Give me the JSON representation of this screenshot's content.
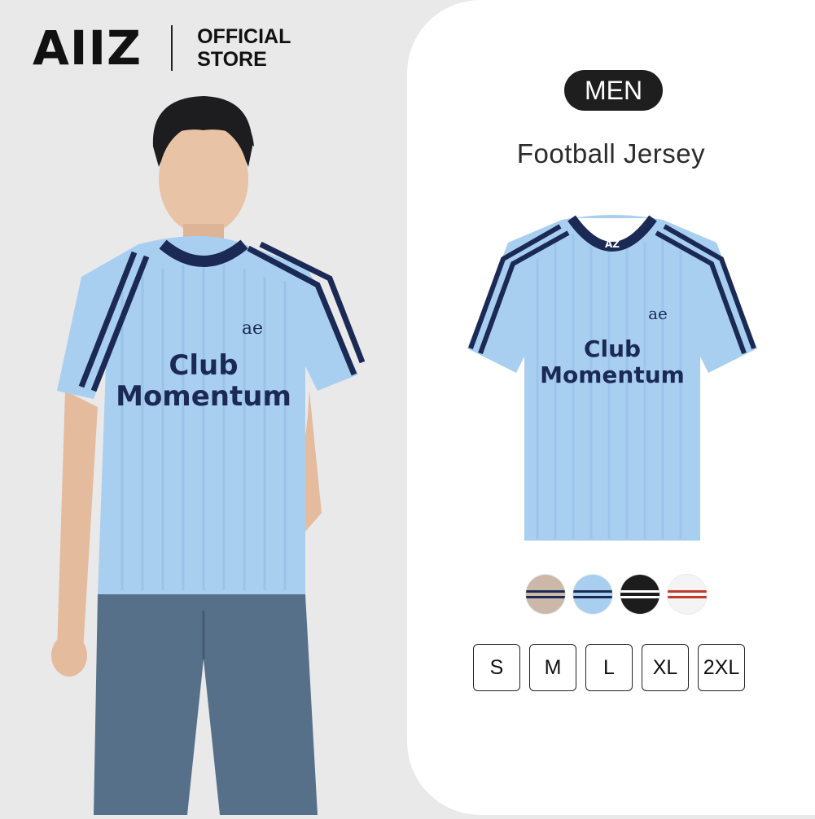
{
  "brand": {
    "logo": "AIIZ",
    "store_line1": "OFFICIAL",
    "store_line2": "STORE"
  },
  "product": {
    "gender": "MEN",
    "name": "Football Jersey",
    "print_line1": "Club",
    "print_line2": "Momentum",
    "chest_logo": "ae",
    "neck_logo": "AZ"
  },
  "colors": {
    "jersey": "#a9cff0",
    "trim": "#1b2a55",
    "card_bg": "#ffffff",
    "page_bg": "#e9e9ea"
  },
  "swatches": [
    {
      "name": "beige",
      "color": "#cbb8a8",
      "stripe": "#1b2a55"
    },
    {
      "name": "sky-blue",
      "color": "#a9cff0",
      "stripe": "#1b2a55"
    },
    {
      "name": "black",
      "color": "#1c1c1c",
      "stripe": "#ffffff"
    },
    {
      "name": "white",
      "color": "#f4f4f4",
      "stripe": "#c0392b"
    }
  ],
  "sizes": [
    "S",
    "M",
    "L",
    "XL",
    "2XL"
  ]
}
